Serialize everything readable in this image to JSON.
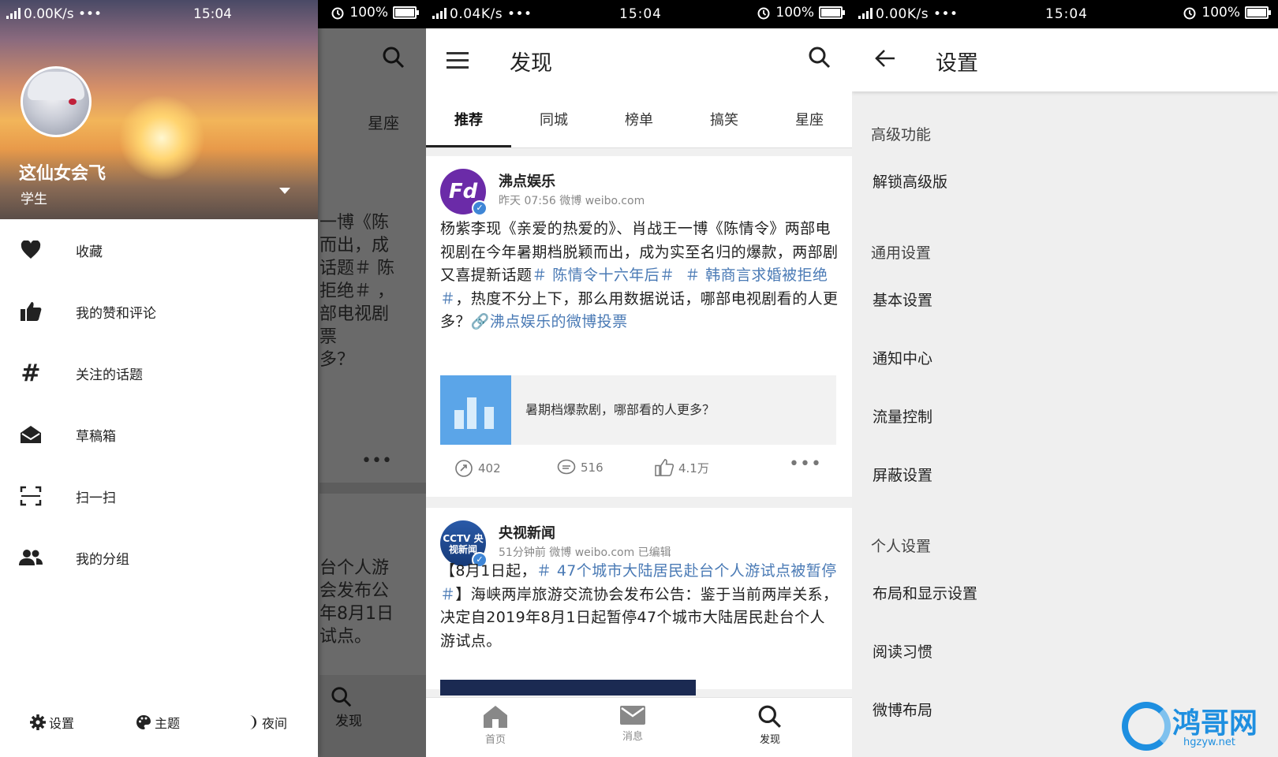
{
  "status_bars": [
    {
      "net": "0.00K/s •••",
      "time": "15:04",
      "battery": "100%"
    },
    {
      "net": "0.04K/s •••",
      "time": "15:04",
      "battery": "100%"
    },
    {
      "net": "0.00K/s •••",
      "time": "15:04",
      "battery": "100%"
    }
  ],
  "drawer": {
    "profile_name": "这仙女会飞",
    "profile_role": "学生",
    "menu": [
      {
        "label": "收藏",
        "icon": "heart-icon"
      },
      {
        "label": "我的赞和评论",
        "icon": "thumbs-up-icon"
      },
      {
        "label": "关注的话题",
        "icon": "hashtag-icon"
      },
      {
        "label": "草稿箱",
        "icon": "mail-open-icon"
      },
      {
        "label": "扫一扫",
        "icon": "scan-icon"
      },
      {
        "label": "我的分组",
        "icon": "group-icon"
      }
    ],
    "footer": {
      "settings": "设置",
      "theme": "主题",
      "night": "夜间"
    },
    "behind": {
      "tab": "星座",
      "lines1": [
        "一博《陈",
        "而出，成",
        "话题＃ 陈",
        "拒绝＃ ，",
        "部电视剧",
        "票",
        "",
        "多？"
      ],
      "lines2": [
        "台个人游",
        "会发布公",
        "年8月1日",
        "试点。"
      ],
      "nav_label": "发现"
    }
  },
  "discover": {
    "title": "发现",
    "tabs": [
      "推荐",
      "同城",
      "榜单",
      "搞笑",
      "星座"
    ],
    "posts": [
      {
        "user": "沸点娱乐",
        "avatar_text": "Fd",
        "meta": "昨天 07:56   微博 weibo.com",
        "text_plain_1": "杨紫李现《亲爱的热爱的》、肖战王一博《陈情令》两部电视剧在今年暑期档脱颖而出，成为实至名归的爆款，两部剧又喜提新话题",
        "topic_1": "＃ 陈情令十六年后＃",
        "topic_2": "＃ 韩商言求婚被拒绝＃",
        "text_plain_2": "，热度不分上下，那么用数据说话，哪部电视剧看的人更多？",
        "link": "🔗沸点娱乐的微博投票",
        "link_card_title": "暑期档爆款剧，哪部看的人更多？",
        "reposts": "402",
        "comments": "516",
        "likes": "4.1万"
      },
      {
        "user": "央视新闻",
        "avatar_text": "CCTV 央视新闻",
        "meta": "51分钟前   微博 weibo.com  已编辑",
        "text_plain_1": "【8月1日起，",
        "topic_1": "＃ 47个城市大陆居民赴台个人游试点被暂停＃",
        "text_plain_2": "】海峡两岸旅游交流协会发布公告：鉴于当前两岸关系，决定自2019年8月1日起暂停47个城市大陆居民赴台个人游试点。"
      }
    ],
    "bottom_nav": [
      "首页",
      "消息",
      "发现"
    ]
  },
  "settings": {
    "title": "设置",
    "sections": [
      {
        "header": "高级功能",
        "items": [
          "解锁高级版"
        ]
      },
      {
        "header": "通用设置",
        "items": [
          "基本设置",
          "通知中心",
          "流量控制",
          "屏蔽设置"
        ]
      },
      {
        "header": "个人设置",
        "items": [
          "布局和显示设置",
          "阅读习惯",
          "微博布局"
        ]
      }
    ]
  },
  "watermark": {
    "name": "鸿哥网",
    "url": "hgzyw.net"
  },
  "colors": {
    "topic": "#4a7ab5",
    "verified": "#3f86d6",
    "watermark": "#1e8fe0"
  }
}
